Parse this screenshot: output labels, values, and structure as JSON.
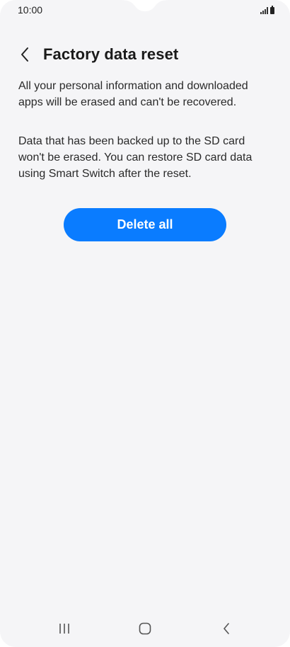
{
  "status_bar": {
    "time": "10:00",
    "icons": [
      "signal-icon",
      "battery-icon"
    ]
  },
  "header": {
    "back_icon": "chevron-left-icon",
    "title": "Factory data reset"
  },
  "content": {
    "paragraph_1": "All your personal information and downloaded apps will be erased and can't be recovered.",
    "paragraph_2": "Data that has been backed up to the SD card won't be erased. You can restore SD card data using Smart Switch after the reset."
  },
  "actions": {
    "delete_all_label": "Delete all"
  },
  "nav_bar": {
    "buttons": [
      "recents-icon",
      "home-icon",
      "back-icon"
    ]
  },
  "colors": {
    "background": "#f5f5f7",
    "accent": "#0a7cff",
    "text": "#1c1c1c"
  }
}
